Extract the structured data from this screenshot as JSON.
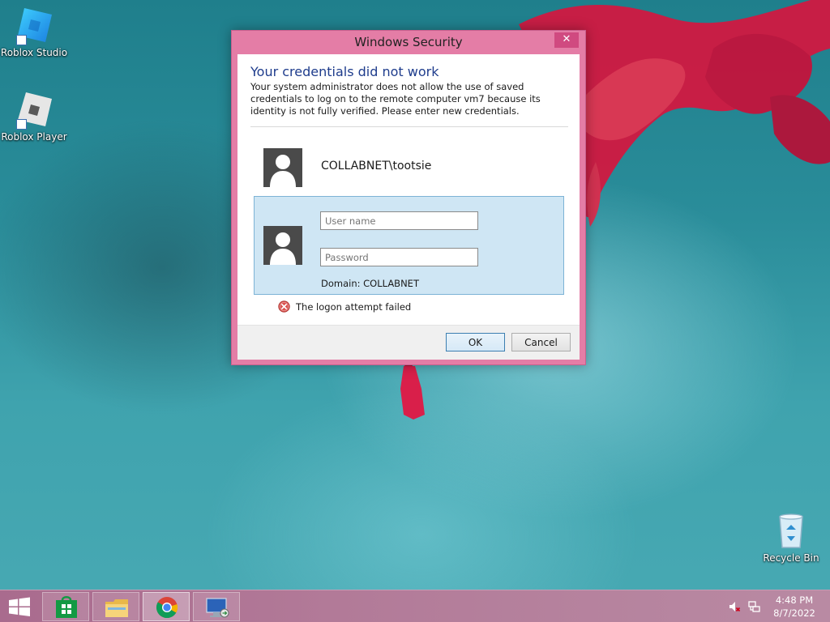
{
  "desktop": {
    "icons": [
      {
        "label": "Roblox Studio",
        "icon": "roblox-studio-icon"
      },
      {
        "label": "Roblox Player",
        "icon": "roblox-player-icon"
      },
      {
        "label": "Recycle Bin",
        "icon": "recycle-bin-icon"
      }
    ]
  },
  "dialog": {
    "title": "Windows Security",
    "close_glyph": "✕",
    "heading": "Your credentials did not work",
    "message": "Your system administrator does not allow the use of saved credentials to log on to the remote computer vm7 because its identity is not fully verified. Please enter new credentials.",
    "saved_account": "COLLABNET\\tootsie",
    "username_value": "",
    "username_placeholder": "User name",
    "password_value": "",
    "password_placeholder": "Password",
    "domain_label": "Domain: COLLABNET",
    "error_text": "The logon attempt failed",
    "ok_label": "OK",
    "cancel_label": "Cancel"
  },
  "taskbar": {
    "start_icon": "windows-logo-icon",
    "pinned": [
      {
        "name": "store",
        "icon": "store-icon"
      },
      {
        "name": "file-explorer",
        "icon": "file-explorer-icon"
      },
      {
        "name": "chrome",
        "icon": "chrome-icon"
      },
      {
        "name": "remote-desktop",
        "icon": "remote-desktop-icon"
      }
    ],
    "tray": {
      "time": "4:48 PM",
      "date": "8/7/2022"
    }
  },
  "colors": {
    "accent": "#e47da6",
    "heading": "#1e3c8c",
    "credential_box": "#cfe6f4",
    "error": "#c0392b"
  }
}
